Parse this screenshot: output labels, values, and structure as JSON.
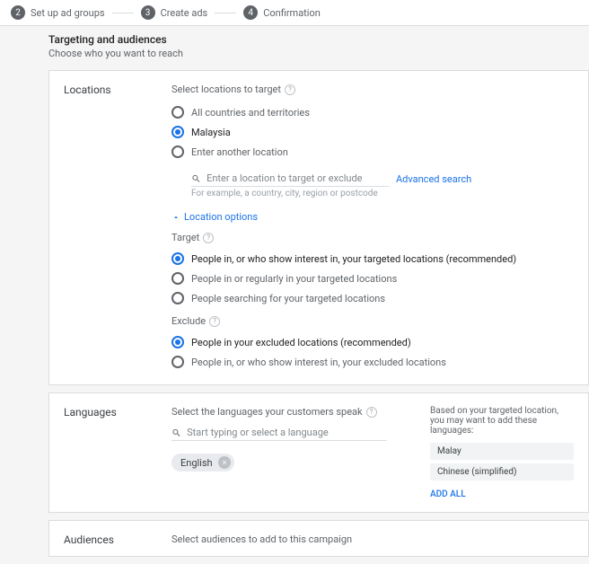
{
  "stepper": {
    "step2_num": "2",
    "step2_label": "Set up ad groups",
    "step3_num": "3",
    "step3_label": "Create ads",
    "step4_num": "4",
    "step4_label": "Confirmation"
  },
  "header": {
    "title": "Targeting and audiences",
    "subtitle": "Choose who you want to reach"
  },
  "locations": {
    "label": "Locations",
    "select_title": "Select locations to target",
    "opt_all": "All countries and territories",
    "opt_country": "Malaysia",
    "opt_enter": "Enter another location",
    "search_placeholder": "Enter a location to target or exclude",
    "advanced_search": "Advanced search",
    "hint": "For example, a country, city, region or postcode",
    "options_toggle": "Location options",
    "target_title": "Target",
    "target_opt1": "People in, or who show interest in, your targeted locations (recommended)",
    "target_opt2": "People in or regularly in your targeted locations",
    "target_opt3": "People searching for your targeted locations",
    "exclude_title": "Exclude",
    "exclude_opt1": "People in your excluded locations (recommended)",
    "exclude_opt2": "People in, or who show interest in, your excluded locations"
  },
  "languages": {
    "label": "Languages",
    "select_title": "Select the languages your customers speak",
    "search_placeholder": "Start typing or select a language",
    "chip": "English",
    "aside_text": "Based on your targeted location, you may want to add these languages:",
    "suggestion1": "Malay",
    "suggestion2": "Chinese (simplified)",
    "add_all": "ADD ALL"
  },
  "audiences": {
    "label": "Audiences",
    "select_title": "Select audiences to add to this campaign"
  }
}
